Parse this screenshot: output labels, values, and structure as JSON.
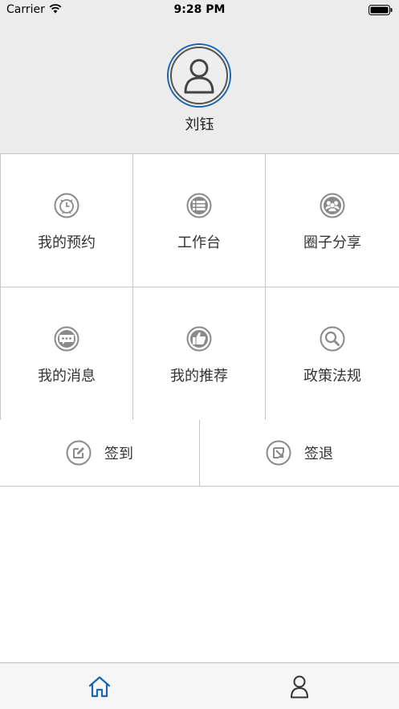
{
  "status_bar": {
    "carrier": "Carrier",
    "time": "9:28 PM"
  },
  "profile": {
    "name": "刘钰"
  },
  "grid": [
    {
      "label": "我的预约",
      "icon": "alarm-clock-icon"
    },
    {
      "label": "工作台",
      "icon": "list-icon"
    },
    {
      "label": "圈子分享",
      "icon": "group-icon"
    },
    {
      "label": "我的消息",
      "icon": "chat-bubble-icon"
    },
    {
      "label": "我的推荐",
      "icon": "thumbs-up-icon"
    },
    {
      "label": "政策法规",
      "icon": "magnifier-icon"
    }
  ],
  "sign": {
    "sign_in": "签到",
    "sign_out": "签退"
  },
  "tabs": [
    {
      "name": "home",
      "icon": "home-icon",
      "active": true
    },
    {
      "name": "profile",
      "icon": "person-icon",
      "active": false
    }
  ],
  "colors": {
    "accent": "#1a66b3",
    "icon_gray": "#8a8a8a",
    "header_bg": "#ececec"
  }
}
